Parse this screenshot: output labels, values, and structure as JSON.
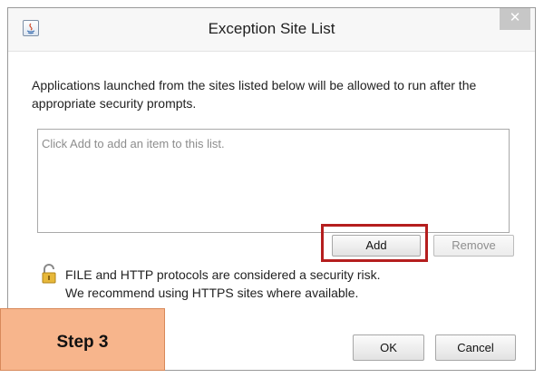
{
  "dialog": {
    "title": "Exception Site List",
    "close_glyph": "✕",
    "description": "Applications launched from the sites listed below will be allowed to run after the appropriate security prompts.",
    "list_placeholder": "Click Add to add an item to this list.",
    "add_label": "Add",
    "remove_label": "Remove",
    "warning_line1": "FILE and HTTP protocols are considered a security risk.",
    "warning_line2": "We recommend using HTTPS sites where available.",
    "ok_label": "OK",
    "cancel_label": "Cancel"
  },
  "annotation": {
    "step_label": "Step 3",
    "highlight_color": "#b51e1e",
    "step_color": "#f7b58c"
  },
  "icons": {
    "app": "java-icon",
    "warning": "lock-icon"
  }
}
